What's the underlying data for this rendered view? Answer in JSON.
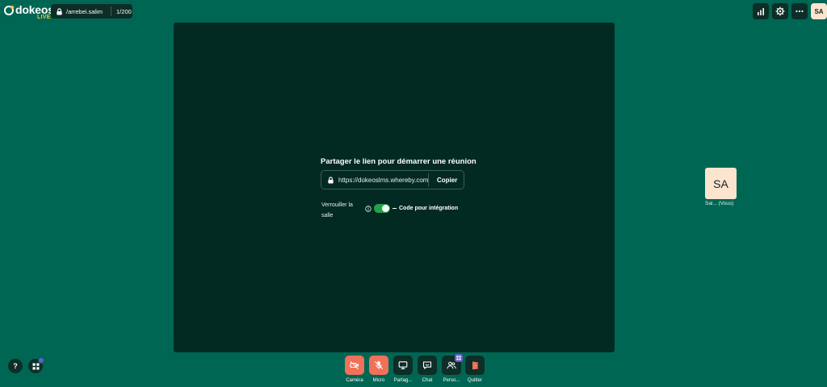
{
  "app": {
    "logo_name": "dokeos",
    "logo_sub": "LIVE"
  },
  "room": {
    "name": "/arrebei.salim",
    "count": "1/200"
  },
  "top_right": {
    "user_initials": "SA",
    "icons": [
      "stats-icon",
      "settings-icon",
      "more-icon"
    ]
  },
  "share": {
    "title": "Partager le lien pour démarrer une réunion",
    "url": "https://dokeoslms.whereby.com",
    "copy_label": "Copier",
    "lock_label": "Verrouiller la salle",
    "lock_enabled": true,
    "embed_label": "Code pour intégration"
  },
  "participant": {
    "initials": "SA",
    "name": "Sal... (Vous)"
  },
  "bottom_left": {
    "help_label": "?"
  },
  "toolbar": {
    "camera": "Caméra",
    "micro": "Micro",
    "share": "Partag...",
    "chat": "Chat",
    "people": "Perso...",
    "leave": "Quitter"
  },
  "colors": {
    "background": "#006654",
    "stage": "#032a22",
    "button_dark": "#0d2e26",
    "muted_red": "#f0715a",
    "toggle_on": "#24a148",
    "avatar": "#fbe5cf",
    "badge": "#6a5acd",
    "logo_accent": "#f6c343"
  }
}
